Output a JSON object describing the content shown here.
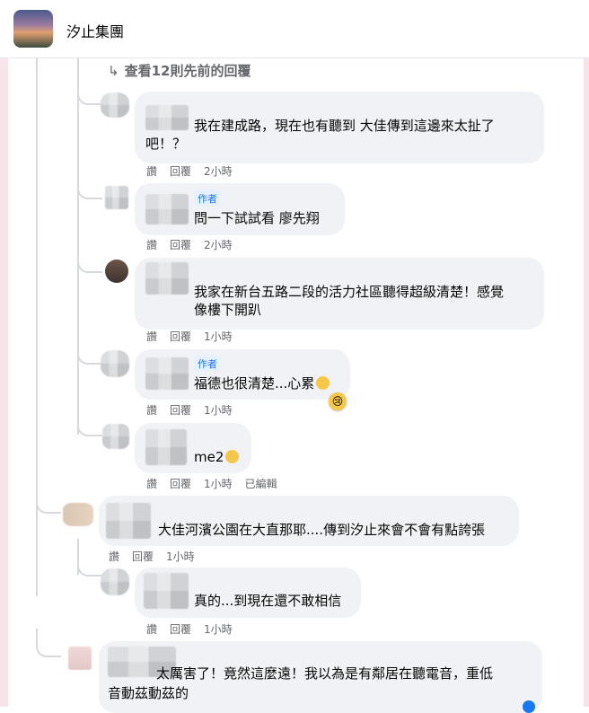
{
  "header": {
    "group_name": "汐止集團"
  },
  "thread": {
    "view_previous": "查看12則先前的回覆"
  },
  "labels": {
    "like": "讚",
    "reply": "回覆",
    "author": "作者",
    "edited": "已編輯"
  },
  "comments": [
    {
      "text": "我在建成路，現在也有聽到 大佳傳到這邊來太扯了",
      "text2": "吧！？",
      "time": "2小時"
    },
    {
      "text": "問一下試試看 廖先翔",
      "time": "2小時"
    },
    {
      "text": "我家在新台五路二段的活力社區聽得超級清楚！感覺",
      "text2": "像樓下開趴",
      "time": "1小時"
    },
    {
      "text": "福德也很清楚...心累",
      "time": "1小時",
      "reaction": "😢"
    },
    {
      "text": "me2",
      "time": "1小時"
    },
    {
      "text": "大佳河濱公園在大直那耶....傳到汐止來會不會有點誇張",
      "time": "1小時"
    },
    {
      "text": "真的...到現在還不敢相信",
      "time": "1小時"
    },
    {
      "text": "太厲害了！竟然這麼遠！我以為是有鄰居在聽電音，重低",
      "text2": "音動茲動茲的"
    }
  ]
}
